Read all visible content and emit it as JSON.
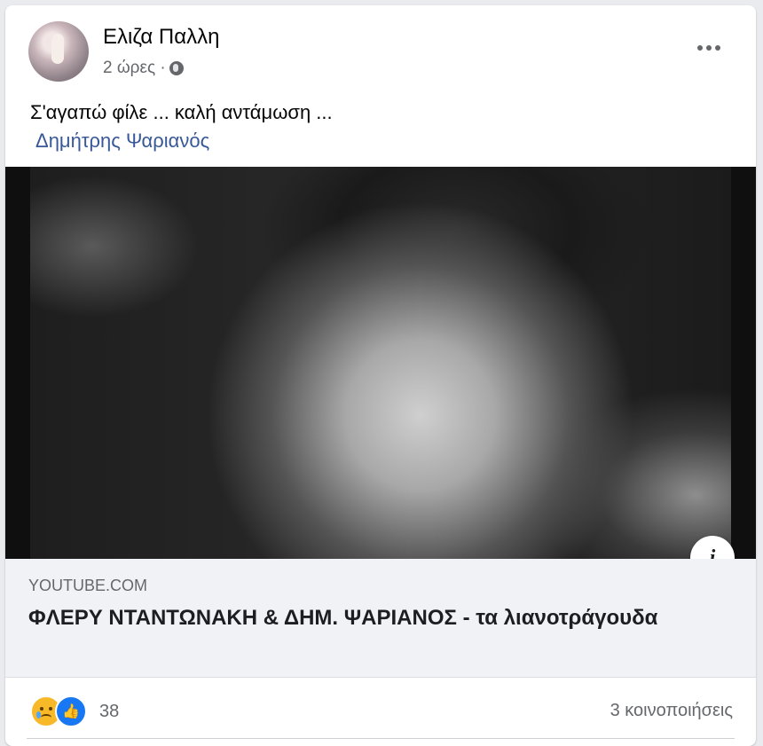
{
  "post": {
    "author": "Ελιζα Παλλη",
    "time": "2 ώρες ·",
    "privacy_icon": "globe-icon",
    "text": "Σ'αγαπώ φίλε ... καλή αντάμωση ...",
    "mention": "Δημήτρης Ψαριανός"
  },
  "link_preview": {
    "domain": "YOUTUBE.COM",
    "title": "ΦΛΕΡΥ ΝΤΑΝΤΩΝΑΚΗ & ΔΗΜ. ΨΑΡΙΑΝΟΣ - τα λιανοτράγουδα",
    "info_label": "i"
  },
  "footer": {
    "reaction_icons": [
      "sad-icon",
      "like-icon"
    ],
    "reaction_count": "38",
    "shares": "3 κοινοποιήσεις"
  },
  "colors": {
    "link": "#385898",
    "secondary_text": "#65676b",
    "like_blue": "#1877f2",
    "sad_yellow": "#f7b928"
  }
}
